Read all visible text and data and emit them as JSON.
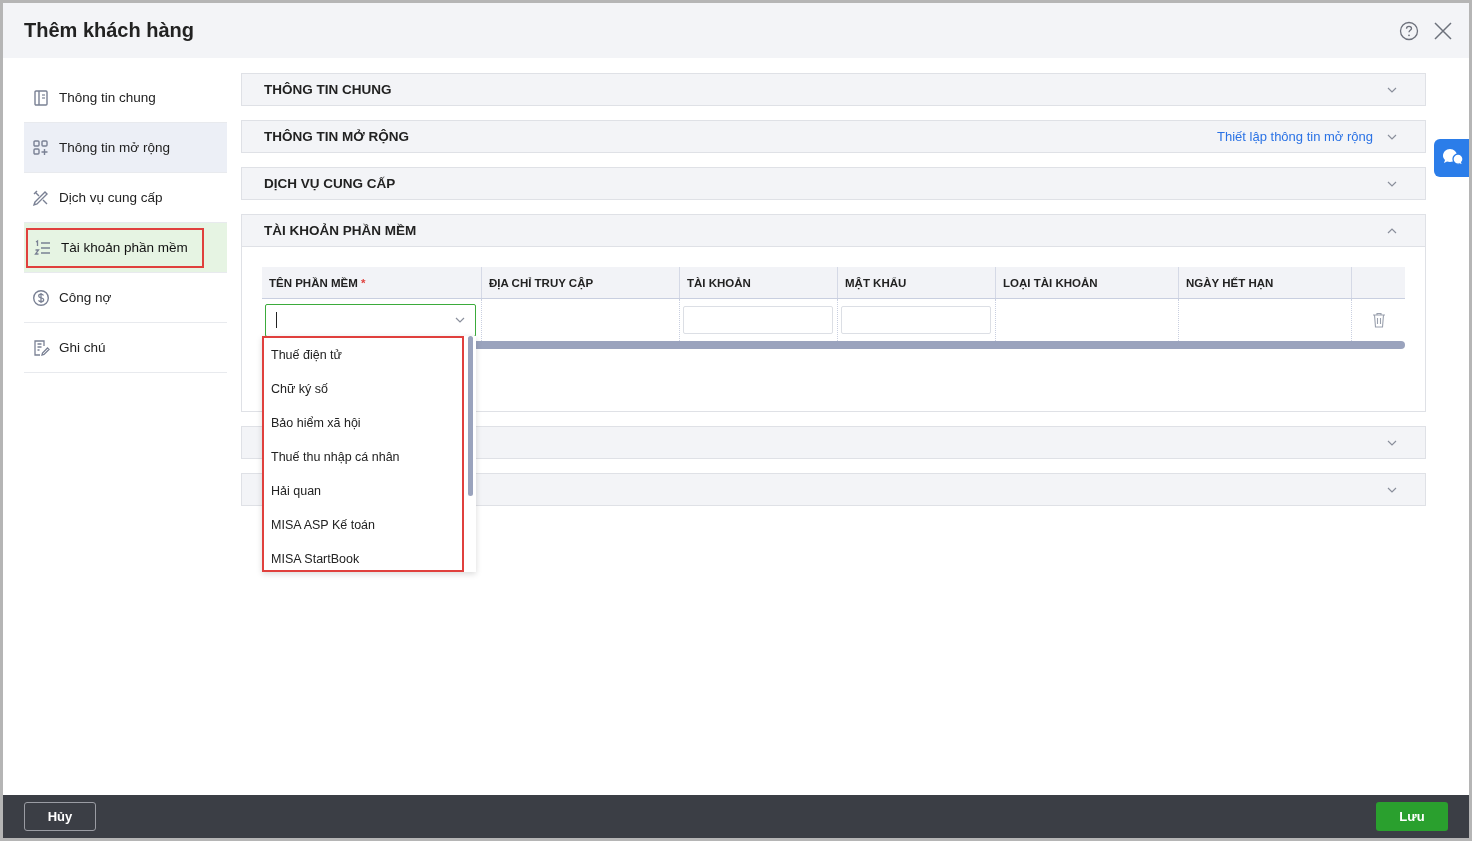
{
  "window": {
    "title": "Thêm khách hàng"
  },
  "sidebar": {
    "items": [
      {
        "label": "Thông tin chung",
        "selected": false,
        "hovered": false,
        "callout": false
      },
      {
        "label": "Thông tin mở rộng",
        "selected": false,
        "hovered": true,
        "callout": false
      },
      {
        "label": "Dịch vụ cung cấp",
        "selected": false,
        "hovered": false,
        "callout": false
      },
      {
        "label": "Tài khoản phần mềm",
        "selected": true,
        "hovered": false,
        "callout": true
      },
      {
        "label": "Công nợ",
        "selected": false,
        "hovered": false,
        "callout": false
      },
      {
        "label": "Ghi chú",
        "selected": false,
        "hovered": false,
        "callout": false
      }
    ]
  },
  "sections": [
    {
      "title": "THÔNG TIN CHUNG",
      "expanded": false
    },
    {
      "title": "THÔNG TIN MỞ RỘNG",
      "link": "Thiết lập thông tin mở rộng",
      "expanded": false
    },
    {
      "title": "DỊCH VỤ CUNG CẤP",
      "expanded": false
    },
    {
      "title": "TÀI KHOẢN PHẦN MỀM",
      "expanded": true,
      "table": {
        "columns": [
          {
            "label": "TÊN PHẦN MỀM",
            "required": true,
            "required_mark": "*"
          },
          {
            "label": "ĐỊA CHỈ TRUY CẬP",
            "required": false
          },
          {
            "label": "TÀI KHOẢN",
            "required": false
          },
          {
            "label": "MẬT KHẨU",
            "required": false
          },
          {
            "label": "LOẠI TÀI KHOẢN",
            "required": false
          },
          {
            "label": "NGÀY HẾT HẠN",
            "required": false
          }
        ],
        "row": {
          "cells": [
            {
              "kind": "combo"
            },
            {
              "kind": "empty"
            },
            {
              "kind": "input"
            },
            {
              "kind": "input"
            },
            {
              "kind": "empty"
            },
            {
              "kind": "empty"
            }
          ]
        },
        "dropdown": {
          "callout": true,
          "options": [
            "Thuế điện tử",
            "Chữ ký số",
            "Bảo hiểm xã hội",
            "Thuế thu nhập cá nhân",
            "Hải quan",
            "MISA ASP Kế toán",
            "MISA StartBook"
          ]
        }
      }
    },
    {
      "expanded": false
    },
    {
      "expanded": false
    }
  ],
  "footer": {
    "cancel": "Hủy",
    "save": "Lưu"
  }
}
